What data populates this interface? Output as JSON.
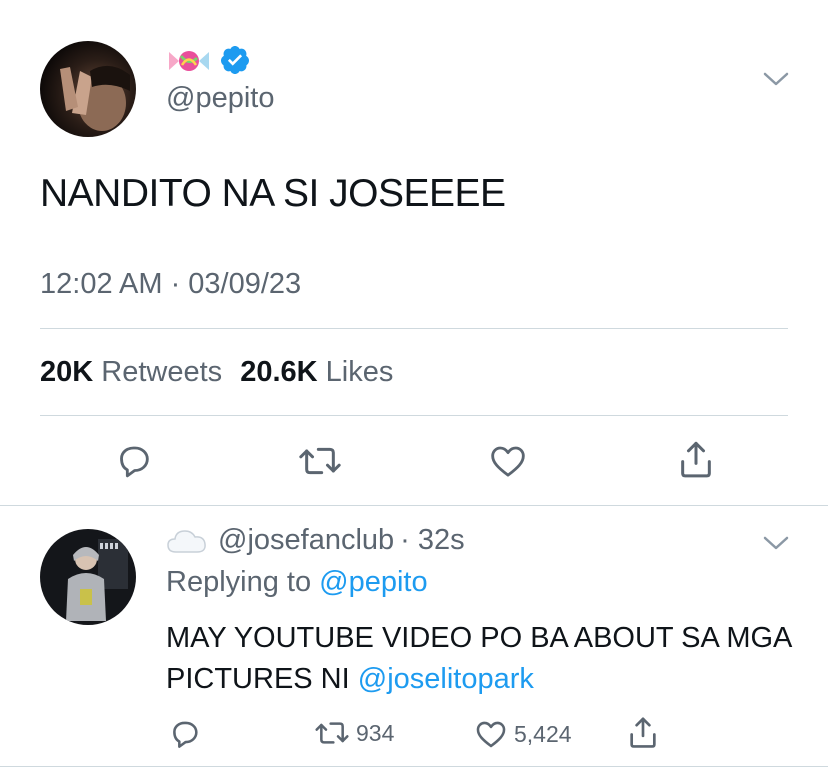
{
  "tweet": {
    "name_emoji": "candy",
    "verified_icon": "verified-badge-icon",
    "handle": "@pepito",
    "text": "NANDITO NA SI JOSEEEE",
    "timestamp": "12:02 AM · 03/09/23",
    "retweets_count": "20K",
    "retweets_label": "Retweets",
    "likes_count": "20.6K",
    "likes_label": "Likes"
  },
  "reply": {
    "name_emoji": "cloud",
    "handle": "@josefanclub",
    "time": "· 32s",
    "replying_prefix": "Replying to",
    "replying_to": "@pepito",
    "text": "MAY YOUTUBE VIDEO PO BA ABOUT SA MGA PICTURES NI",
    "mention": "@joselitopark",
    "retweets": "934",
    "likes": "5,424"
  },
  "colors": {
    "text": "#0f1419",
    "secondary": "#5b6570",
    "link": "#1d9bf0",
    "verified": "#1d9bf0",
    "divider": "#cfd9de"
  }
}
